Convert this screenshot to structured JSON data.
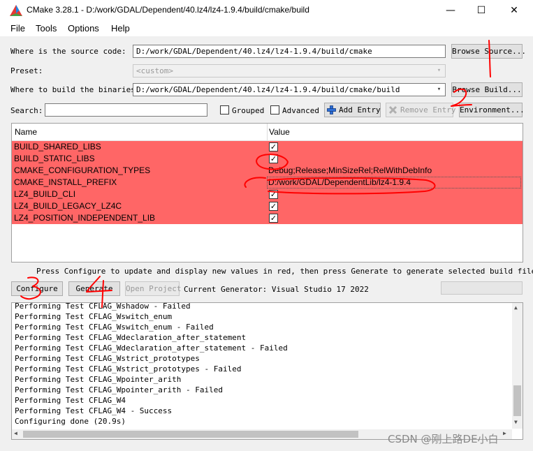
{
  "window": {
    "title": "CMake 3.28.1 - D:/work/GDAL/Dependent/40.lz4/lz4-1.9.4/build/cmake/build",
    "minimize": "—",
    "maximize": "☐",
    "close": "✕"
  },
  "menu": [
    "File",
    "Tools",
    "Options",
    "Help"
  ],
  "form": {
    "source_label": "Where is the source code:",
    "source_value": "D:/work/GDAL/Dependent/40.lz4/lz4-1.9.4/build/cmake",
    "browse_source": "Browse Source...",
    "preset_label": "Preset:",
    "preset_value": "<custom>",
    "build_label": "Where to build the binaries:",
    "build_value": "D:/work/GDAL/Dependent/40.lz4/lz4-1.9.4/build/cmake/build",
    "browse_build": "Browse Build...",
    "search_label": "Search:",
    "search_value": "",
    "grouped": "Grouped",
    "advanced": "Advanced",
    "add_entry": "Add Entry",
    "remove_entry": "Remove Entry",
    "environment": "Environment..."
  },
  "table": {
    "col_name": "Name",
    "col_value": "Value",
    "rows": [
      {
        "name": "BUILD_SHARED_LIBS",
        "value": "✓"
      },
      {
        "name": "BUILD_STATIC_LIBS",
        "value": "✓"
      },
      {
        "name": "CMAKE_CONFIGURATION_TYPES",
        "value": "Debug;Release;MinSizeRel;RelWithDebInfo"
      },
      {
        "name": "CMAKE_INSTALL_PREFIX",
        "value": "D:/work/GDAL/DependentLib/lz4-1.9.4"
      },
      {
        "name": "LZ4_BUILD_CLI",
        "value": "✓"
      },
      {
        "name": "LZ4_BUILD_LEGACY_LZ4C",
        "value": "✓"
      },
      {
        "name": "LZ4_POSITION_INDEPENDENT_LIB",
        "value": "✓"
      }
    ],
    "row_color": "#ff6666"
  },
  "hint": "Press Configure to update and display new values in red, then press Generate to generate selected build files.",
  "actions": {
    "configure": "Configure",
    "generate": "Generate",
    "open_project": "Open Project",
    "generator": "Current Generator: Visual Studio 17 2022"
  },
  "log": [
    "Performing Test CFLAG_Wshadow - Failed",
    "Performing Test CFLAG_Wswitch_enum",
    "Performing Test CFLAG_Wswitch_enum - Failed",
    "Performing Test CFLAG_Wdeclaration_after_statement",
    "Performing Test CFLAG_Wdeclaration_after_statement - Failed",
    "Performing Test CFLAG_Wstrict_prototypes",
    "Performing Test CFLAG_Wstrict_prototypes - Failed",
    "Performing Test CFLAG_Wpointer_arith",
    "Performing Test CFLAG_Wpointer_arith - Failed",
    "Performing Test CFLAG_W4",
    "Performing Test CFLAG_W4 - Success",
    "Configuring done (20.9s)"
  ],
  "watermark": "CSDN @刚上路DE小白",
  "annotation_color": "#ff0000",
  "icons": {
    "app": "cmake-triangle-icon",
    "add": "plus-icon",
    "remove": "x-icon"
  }
}
